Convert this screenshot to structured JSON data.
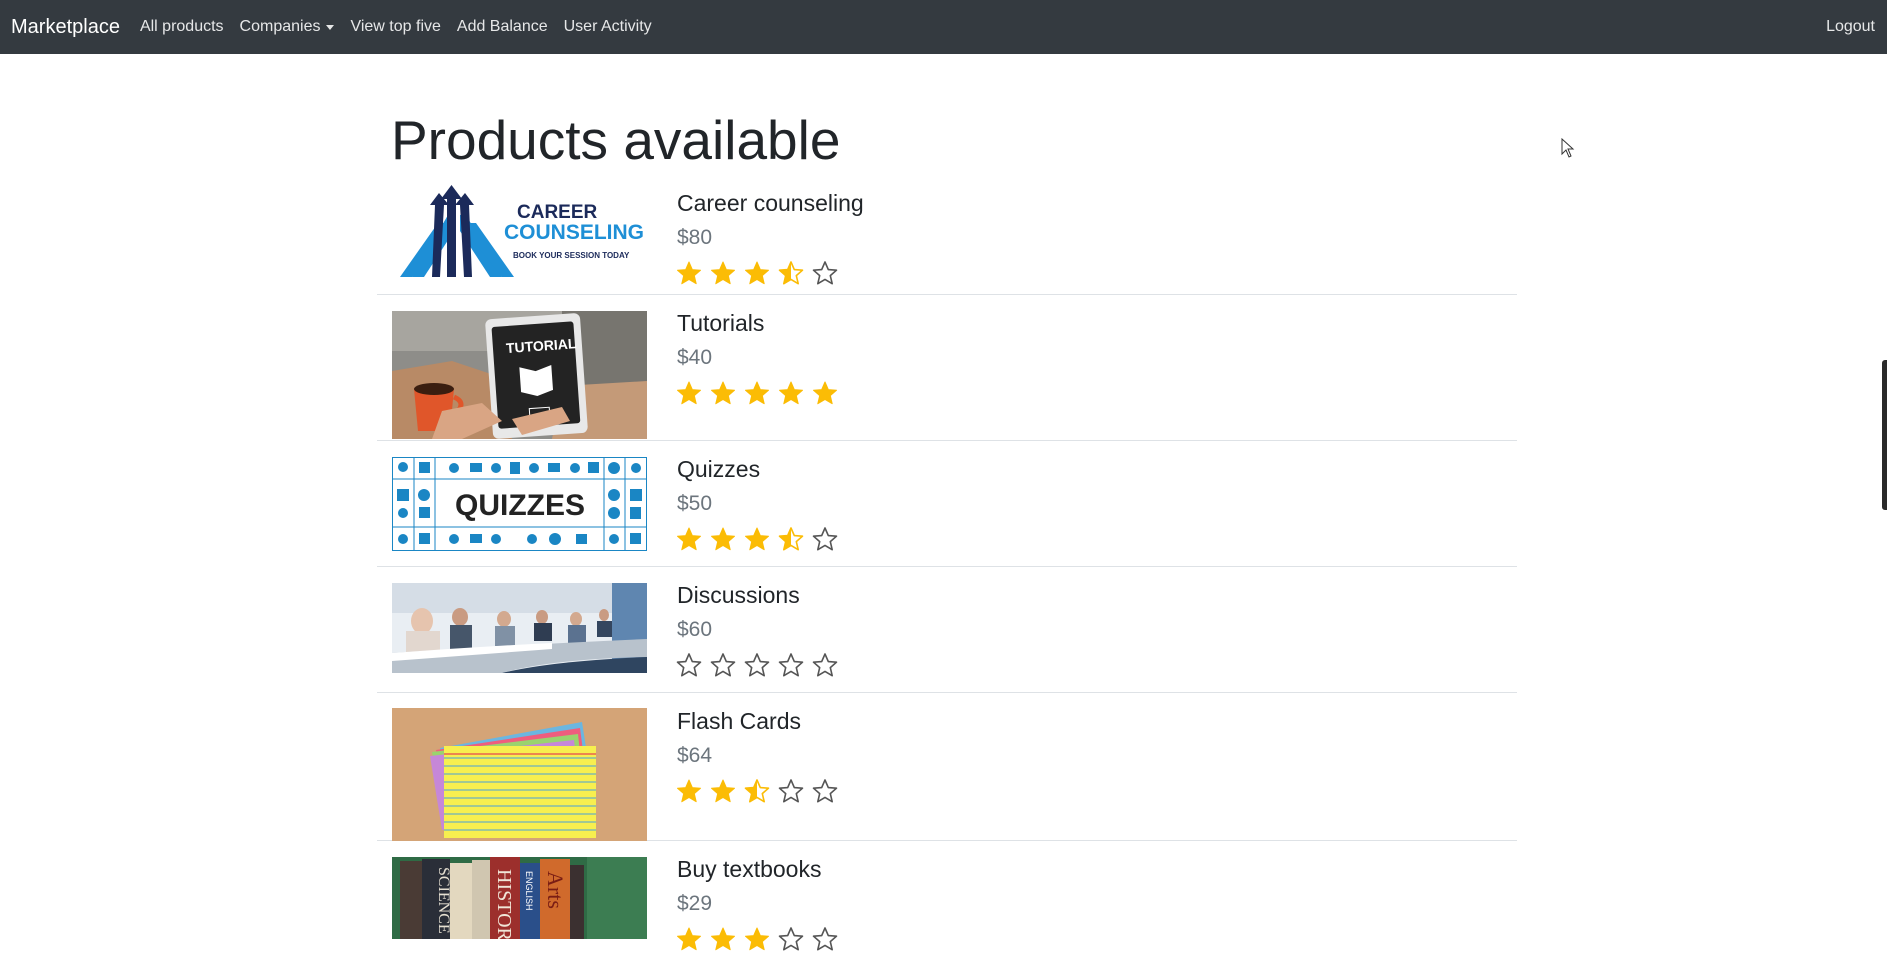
{
  "navbar": {
    "brand": "Marketplace",
    "links": [
      "All products",
      "Companies",
      "View top five",
      "Add Balance",
      "User Activity"
    ],
    "logout": "Logout"
  },
  "page": {
    "title": "Products available"
  },
  "colors": {
    "navbar_bg": "#343a40",
    "star_filled": "#fbbc05",
    "star_empty_outline": "#555555",
    "price_text": "#6c757d",
    "divider": "#dee2e6"
  },
  "products": [
    {
      "name": "Career counseling",
      "price": "$80",
      "rating": 3.5,
      "image": {
        "icon": "career-counseling-logo",
        "line1": "CAREER",
        "line2": "COUNSELING",
        "line3": "BOOK YOUR SESSION TODAY"
      }
    },
    {
      "name": "Tutorials",
      "price": "$40",
      "rating": 5,
      "image": {
        "icon": "tutorial-tablet-photo",
        "line1": "TUTORIAL"
      }
    },
    {
      "name": "Quizzes",
      "price": "$50",
      "rating": 3.5,
      "image": {
        "icon": "quizzes-banner",
        "line1": "QUIZZES"
      }
    },
    {
      "name": "Discussions",
      "price": "$60",
      "rating": 0,
      "image": {
        "icon": "meeting-room-photo"
      }
    },
    {
      "name": "Flash Cards",
      "price": "$64",
      "rating": 2.5,
      "image": {
        "icon": "flash-cards-photo"
      }
    },
    {
      "name": "Buy textbooks",
      "price": "$29",
      "rating": 3,
      "image": {
        "icon": "textbooks-photo",
        "line1": "SCIENCE",
        "line2": "HISTORY",
        "line3": "ENGLISH",
        "line4": "Arts"
      }
    }
  ]
}
